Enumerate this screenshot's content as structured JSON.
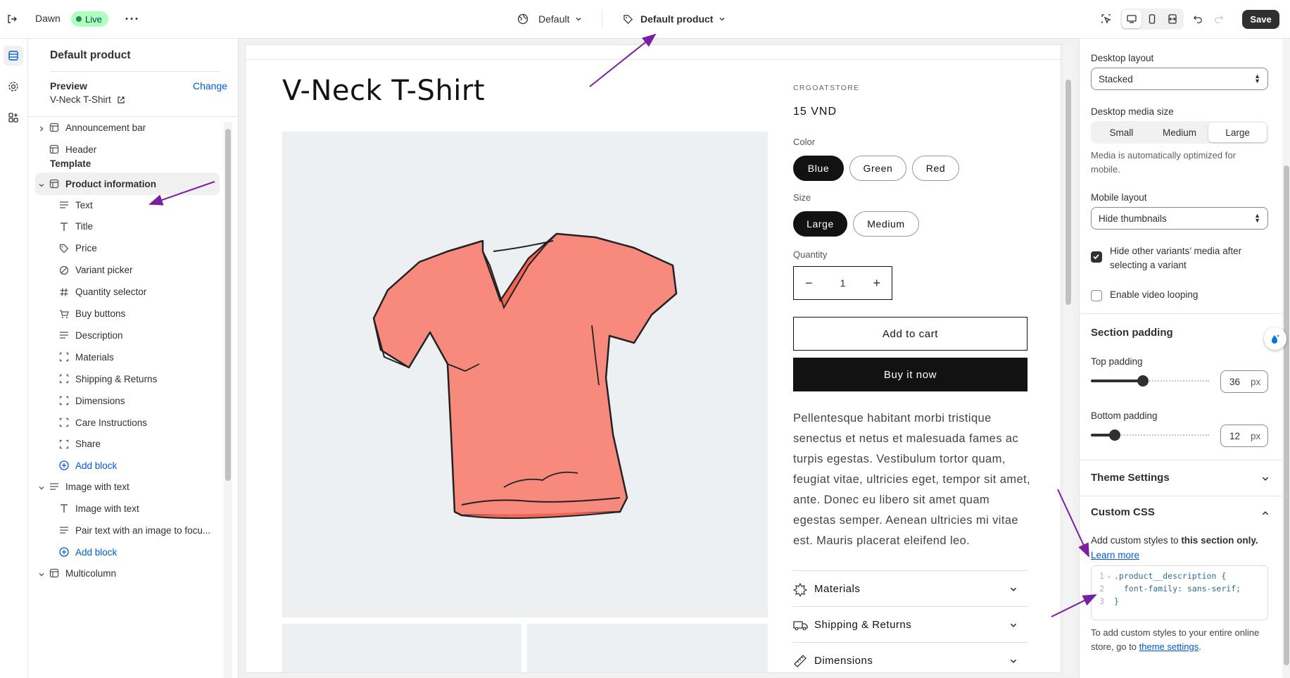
{
  "topbar": {
    "theme_name": "Dawn",
    "live_badge": "Live",
    "template_select": "Default",
    "page_select": "Default product",
    "save_label": "Save"
  },
  "left_panel": {
    "title": "Default product",
    "preview_label": "Preview",
    "preview_change": "Change",
    "preview_product": "V-Neck T-Shirt",
    "header_items": [
      {
        "label": "Announcement bar",
        "icon": "layout-section-icon"
      },
      {
        "label": "Header",
        "icon": "layout-section-icon"
      }
    ],
    "template_heading": "Template",
    "product_information": "Product information",
    "product_blocks": [
      {
        "label": "Text",
        "icon": "text-lines-icon"
      },
      {
        "label": "Title",
        "icon": "title-t-icon"
      },
      {
        "label": "Price",
        "icon": "price-tag-icon"
      },
      {
        "label": "Variant picker",
        "icon": "variant-icon"
      },
      {
        "label": "Quantity selector",
        "icon": "hash-icon"
      },
      {
        "label": "Buy buttons",
        "icon": "cart-icon"
      },
      {
        "label": "Description",
        "icon": "text-lines-icon"
      },
      {
        "label": "Materials",
        "icon": "collapsible-icon"
      },
      {
        "label": "Shipping & Returns",
        "icon": "collapsible-icon"
      },
      {
        "label": "Dimensions",
        "icon": "collapsible-icon"
      },
      {
        "label": "Care Instructions",
        "icon": "collapsible-icon"
      },
      {
        "label": "Share",
        "icon": "collapsible-icon"
      }
    ],
    "add_block": "Add block",
    "image_with_text": "Image with text",
    "iwt_blocks": [
      {
        "label": "Image with text",
        "icon": "title-t-icon"
      },
      {
        "label": "Pair text with an image to focu...",
        "icon": "text-lines-icon"
      }
    ],
    "multicolumn": "Multicolumn"
  },
  "preview": {
    "product_title": "V-Neck T-Shirt",
    "vendor": "CRGOATSTORE",
    "price": "15 VND",
    "color_label": "Color",
    "colors": [
      "Blue",
      "Green",
      "Red"
    ],
    "size_label": "Size",
    "sizes": [
      "Large",
      "Medium"
    ],
    "quantity_label": "Quantity",
    "quantity_value": "1",
    "add_to_cart": "Add to cart",
    "buy_now": "Buy it now",
    "description": "Pellentesque habitant morbi tristique senectus et netus et malesuada fames ac turpis egestas. Vestibulum tortor quam, feugiat vitae, ultricies eget, tempor sit amet, ante. Donec eu libero sit amet quam egestas semper. Aenean ultricies mi vitae est. Mauris placerat eleifend leo.",
    "accordions": [
      "Materials",
      "Shipping & Returns",
      "Dimensions"
    ]
  },
  "right_panel": {
    "desktop_layout_label": "Desktop layout",
    "desktop_layout_value": "Stacked",
    "media_size_label": "Desktop media size",
    "media_sizes": [
      "Small",
      "Medium",
      "Large"
    ],
    "media_note": "Media is automatically optimized for mobile.",
    "mobile_layout_label": "Mobile layout",
    "mobile_layout_value": "Hide thumbnails",
    "hide_variants_label": "Hide other variants’ media after selecting a variant",
    "hide_variants_checked": true,
    "video_loop_label": "Enable video looping",
    "video_loop_checked": false,
    "section_padding": "Section padding",
    "top_padding_label": "Top padding",
    "top_padding_value": "36",
    "top_padding_fraction": 0.36,
    "bottom_padding_label": "Bottom padding",
    "bottom_padding_value": "12",
    "bottom_padding_fraction": 0.12,
    "unit": "px",
    "theme_settings": "Theme Settings",
    "custom_css": "Custom CSS",
    "css_help_prefix": "Add custom styles to ",
    "css_help_bold": "this section only.",
    "learn_more": "Learn more",
    "code_lines": [
      {
        "num": "1",
        "text": ".product__description {"
      },
      {
        "num": "2",
        "text": "  font-family: sans-serif;"
      },
      {
        "num": "3",
        "text": "}"
      }
    ],
    "footer_prefix": "To add custom styles to your entire online store, go to ",
    "footer_link": "theme settings",
    "footer_suffix": "."
  },
  "colors": {
    "accent": "#005bd3",
    "annotation": "#7b1fa2",
    "live_bg": "#affebf",
    "product_bg": "#edf0f3"
  }
}
